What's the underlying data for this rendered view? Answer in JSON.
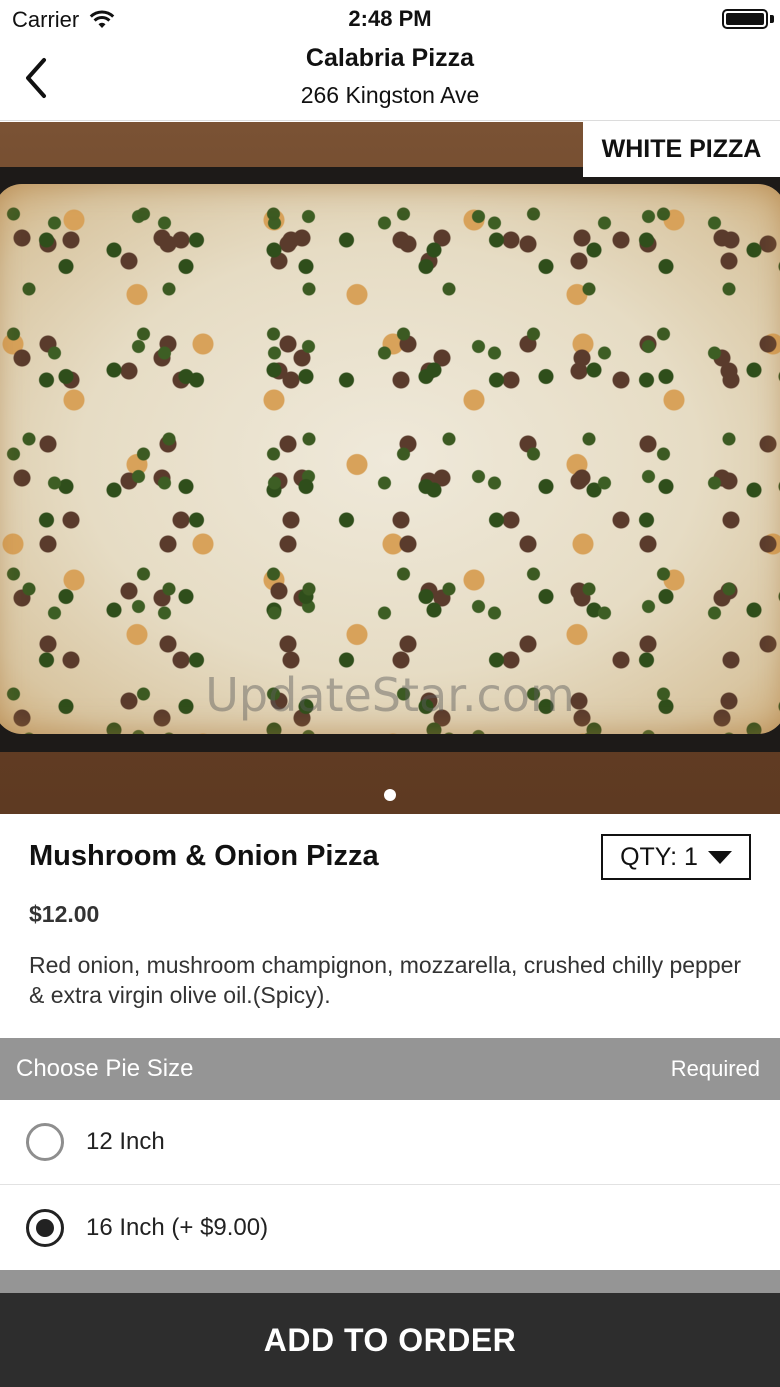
{
  "status_bar": {
    "carrier": "Carrier",
    "time": "2:48 PM",
    "battery_level": 1.0
  },
  "nav": {
    "title": "Calabria Pizza",
    "subtitle": "266 Kingston Ave",
    "back_icon": "chevron-left-icon"
  },
  "hero": {
    "category_tag": "WHITE PIZZA",
    "watermark": "UpdateStar.com",
    "page_count": 1,
    "current_page": 1
  },
  "item": {
    "name": "Mushroom & Onion Pizza",
    "price": "$12.00",
    "description": "Red onion, mushroom champignon, mozzarella, crushed chilly pepper & extra virgin olive oil.(Spicy).",
    "qty_label": "QTY: 1"
  },
  "pie_size": {
    "title": "Choose Pie Size",
    "required_label": "Required",
    "options": [
      {
        "label": "12 Inch",
        "selected": false
      },
      {
        "label": "16 Inch (+ $9.00)",
        "selected": true
      }
    ]
  },
  "footer": {
    "add_button_label": "ADD TO ORDER"
  },
  "colors": {
    "section_header_bg": "#959595",
    "footer_bg": "#2d2d2d",
    "text_primary": "#111111"
  }
}
